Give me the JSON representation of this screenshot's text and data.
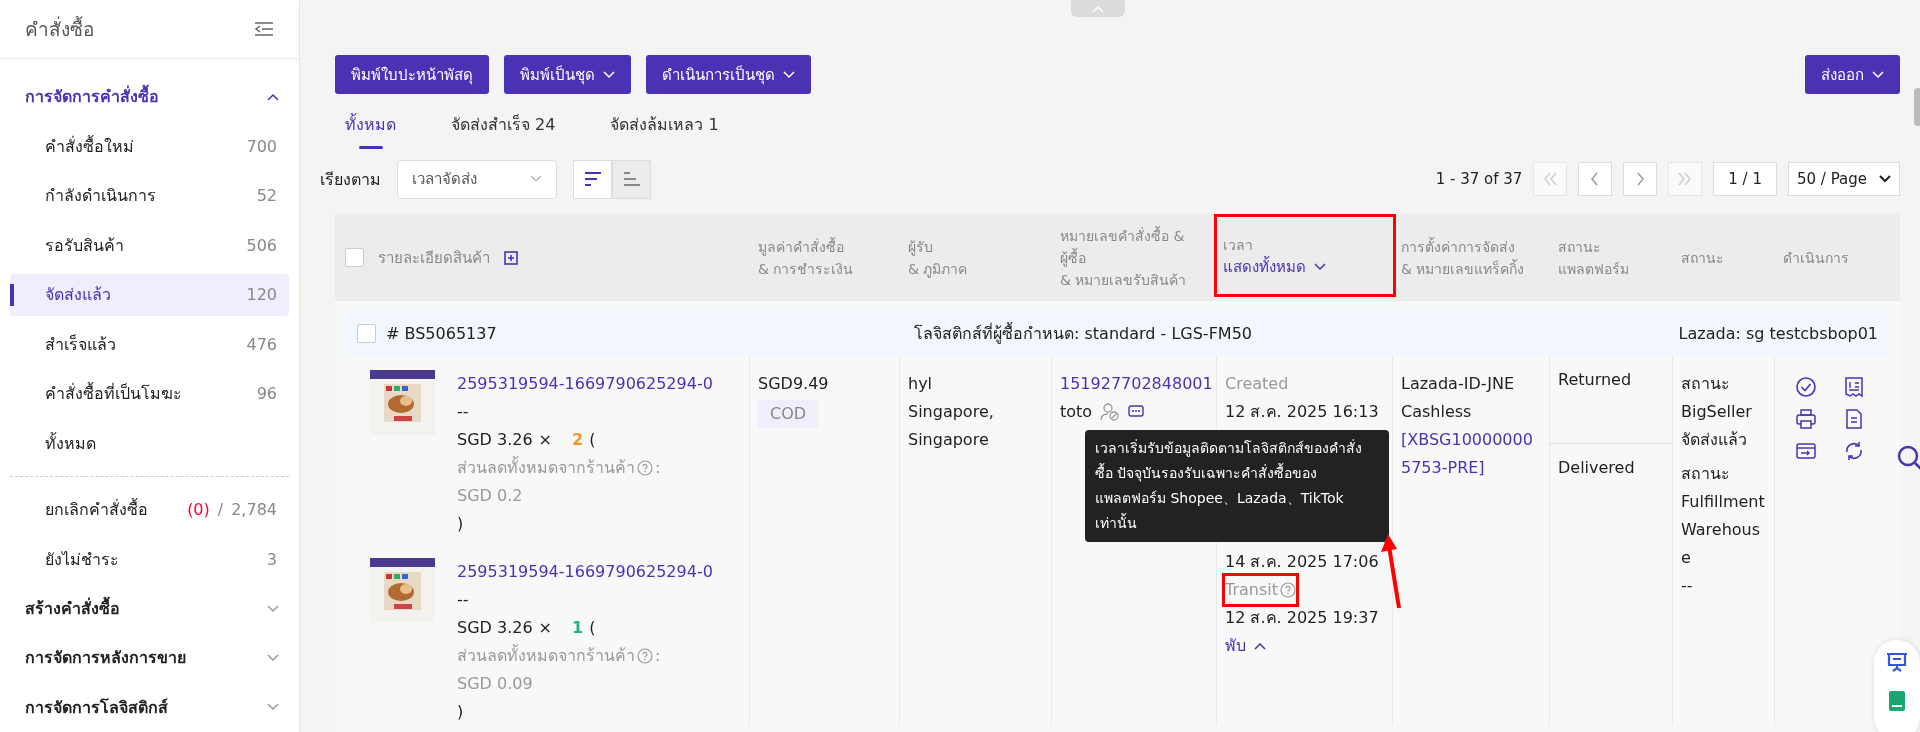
{
  "sidebar": {
    "title": "คำสั่งซื้อ",
    "groups": [
      {
        "label": "การจัดการคำสั่งซื้อ",
        "expanded": true,
        "items": [
          {
            "kind": "link",
            "label": "คำสั่งซื้อใหม่",
            "count": "700",
            "selected": false
          },
          {
            "kind": "link",
            "label": "กำลังดำเนินการ",
            "count": "52",
            "selected": false
          },
          {
            "kind": "link",
            "label": "รอรับสินค้า",
            "count": "506",
            "selected": false
          },
          {
            "kind": "link",
            "label": "จัดส่งแล้ว",
            "count": "120",
            "selected": true
          },
          {
            "kind": "link",
            "label": "สำเร็จแล้ว",
            "count": "476",
            "selected": false
          },
          {
            "kind": "link",
            "label": "คำสั่งซื้อที่เป็นโมฆะ",
            "count": "96",
            "selected": false
          },
          {
            "kind": "link",
            "label": "ทั้งหมด",
            "selected": false
          },
          {
            "kind": "divider"
          },
          {
            "kind": "link",
            "label": "ยกเลิกคำสั่งซื้อ",
            "alert": "(0)",
            "slash": "/",
            "count": "2,784",
            "selected": false
          },
          {
            "kind": "link",
            "label": "ยังไม่ชำระ",
            "count": "3",
            "selected": false
          }
        ]
      },
      {
        "label": "สร้างคำสั่งซื้อ",
        "expanded": false
      },
      {
        "label": "การจัดการหลังการขาย",
        "expanded": false
      },
      {
        "label": "การจัดการโลจิสติกส์",
        "expanded": false
      }
    ]
  },
  "toolbar": {
    "buttons": [
      {
        "label": "พิมพ์ใบปะหน้าพัสดุ",
        "dropdown": false
      },
      {
        "label": "พิมพ์เป็นชุด",
        "dropdown": true
      },
      {
        "label": "ดำเนินการเป็นชุด",
        "dropdown": true
      }
    ],
    "export": {
      "label": "ส่งออก",
      "dropdown": true
    }
  },
  "tabs": [
    {
      "label": "ทั้งหมด",
      "selected": true
    },
    {
      "label": "จัดส่งสำเร็จ 24",
      "selected": false
    },
    {
      "label": "จัดส่งล้มเหลว 1",
      "selected": false
    }
  ],
  "sort": {
    "label": "เรียงตาม",
    "value": "เวลาจัดส่ง",
    "orders": [
      {
        "kind": "desc",
        "selected": true
      },
      {
        "kind": "asc",
        "selected": false
      }
    ]
  },
  "pagination": {
    "range": "1 - 37 of 37",
    "nav": [
      {
        "kind": "first",
        "disabled": true
      },
      {
        "kind": "prev",
        "disabled": false
      },
      {
        "kind": "next",
        "disabled": false
      },
      {
        "kind": "last",
        "disabled": true
      }
    ],
    "page": "1 / 1",
    "page_size": "50 / Page"
  },
  "table": {
    "columns": [
      {
        "kind": "product",
        "label": "รายละเอียดสินค้า",
        "checked": false
      },
      {
        "kind": "text",
        "label": "มูลค่าคำสั่งซื้อ\n& การชำระเงิน"
      },
      {
        "kind": "text",
        "label": "ผู้รับ\n& ภูมิภาค"
      },
      {
        "kind": "text",
        "label": "หมายเลขคำสั่งซื้อ &\nผู้ซื้อ\n& หมายเลขรับสินค้า"
      },
      {
        "kind": "filter",
        "label": "เวลา",
        "filter": "แสดงทั้งหมด",
        "annotated": true
      },
      {
        "kind": "text",
        "label": "การตั้งค่าการจัดส่ง\n& หมายเลขแทร็คกิ้ง"
      },
      {
        "kind": "text",
        "label": "สถานะ\nแพลตฟอร์ม"
      },
      {
        "kind": "text",
        "label": "สถานะ"
      },
      {
        "kind": "text",
        "label": "ดำเนินการ"
      }
    ],
    "orders": [
      {
        "number": "# BS5065137",
        "checked": false,
        "logistics": "โลจิสติกส์ที่ผู้ซื้อกำหนด: standard - LGS-FM50",
        "store": "Lazada: sg testcbsbop01",
        "items": [
          {
            "kind": "picture",
            "sku": "2595319594-1669790625294-0",
            "variant": "--",
            "price": "SGD 3.26",
            "times": "×",
            "qty": "2",
            "color": "#f5962a",
            "open": "(",
            "discount_label": "ส่วนลดทั้งหมดจากร้านค้า",
            "colon": ":",
            "discount": "SGD 0.2",
            "close": ")"
          },
          {
            "kind": "picture",
            "sku": "2595319594-1669790625294-0",
            "variant": "--",
            "price": "SGD 3.26",
            "times": "×",
            "qty": "1",
            "color": "#1fb57c",
            "open": "(",
            "discount_label": "ส่วนลดทั้งหมดจากร้านค้า",
            "colon": ":",
            "discount": "SGD 0.09",
            "close": ")"
          }
        ],
        "value": "SGD9.49",
        "payment": "COD",
        "recipient": "hyl",
        "region": "Singapore, Singapore",
        "order_no": "151927702848001",
        "buyer": "toto",
        "events": [
          {
            "label": "Created",
            "help": false,
            "date": "12 ส.ค. 2025 16:13",
            "annotated": false
          },
          {
            "date": "14 ส.ค. 2025 17:06"
          },
          {
            "label": "Transit",
            "help": true,
            "date": "12 ส.ค. 2025 19:37",
            "annotated": true
          }
        ],
        "collapse": "พับ",
        "carrier": "Lazada-ID-JNE Cashless",
        "tracking": "[XBSG100000005753-PRE]",
        "platform_statuses": [
          "Returned",
          "Delivered"
        ],
        "statuses": [
          {
            "label": "สถานะ BigSeller",
            "value": "จัดส่งแล้ว"
          },
          {
            "label": "สถานะ Fulfillment Warehouse",
            "value": "--"
          }
        ],
        "actions": [
          {
            "kind": "check"
          },
          {
            "kind": "receipt"
          },
          {
            "kind": "print"
          },
          {
            "kind": "document"
          },
          {
            "kind": "card"
          },
          {
            "kind": "sync"
          }
        ]
      }
    ]
  },
  "tooltip": "เวลาเริ่มรับข้อมูลติดตามโลจิสติกส์ของคำสั่งซื้อ ปัจจุบันรองรับเฉพาะคำสั่งซื้อของแพลตฟอร์ม Shopee、Lazada、TikTok เท่านั้น"
}
